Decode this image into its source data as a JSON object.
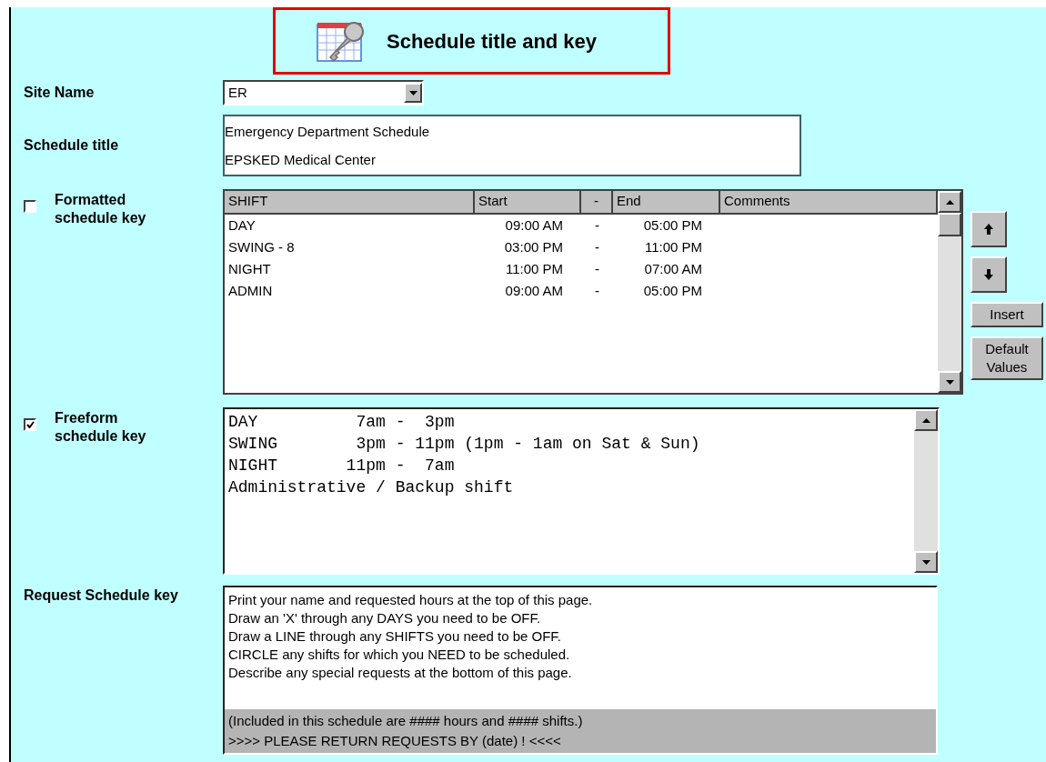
{
  "header": {
    "title": "Schedule title and key"
  },
  "site_name": {
    "label": "Site Name",
    "value": "ER"
  },
  "schedule_title": {
    "label": "Schedule title",
    "lines": [
      "Emergency Department Schedule",
      "EPSKED Medical Center"
    ]
  },
  "formatted_key": {
    "label": "Formatted schedule key",
    "checked": false,
    "columns": [
      "SHIFT",
      "Start",
      "-",
      "End",
      "Comments"
    ],
    "rows": [
      [
        "DAY",
        "09:00 AM",
        "-",
        "05:00 PM",
        ""
      ],
      [
        "SWING - 8",
        "03:00 PM",
        "-",
        "11:00 PM",
        ""
      ],
      [
        "NIGHT",
        "11:00 PM",
        "-",
        "07:00 AM",
        ""
      ],
      [
        "ADMIN",
        "09:00 AM",
        "-",
        "05:00 PM",
        ""
      ]
    ],
    "buttons": [
      {
        "kind": "up"
      },
      {
        "kind": "down"
      },
      {
        "kind": "text",
        "label": "Insert"
      },
      {
        "kind": "text",
        "label": "Default Values"
      }
    ]
  },
  "freeform_key": {
    "label": "Freeform schedule key",
    "checked": true,
    "lines": [
      "DAY          7am -  3pm",
      "SWING        3pm - 11pm (1pm - 1am on Sat & Sun)",
      "NIGHT       11pm -  7am",
      "Administrative / Backup shift"
    ]
  },
  "request_key": {
    "label": "Request Schedule key",
    "lines": [
      "Print your name and requested hours at the top of this page.",
      "Draw an 'X' through any DAYS you need to be OFF.",
      "Draw a LINE through any SHIFTS you need to be OFF.",
      "CIRCLE any shifts for which you NEED to be scheduled.",
      "Describe any special requests at the bottom of this page."
    ],
    "footer_lines": [
      "(Included in this schedule are #### hours and #### shifts.)",
      ">>>> PLEASE RETURN REQUESTS BY (date) ! <<<<"
    ]
  }
}
